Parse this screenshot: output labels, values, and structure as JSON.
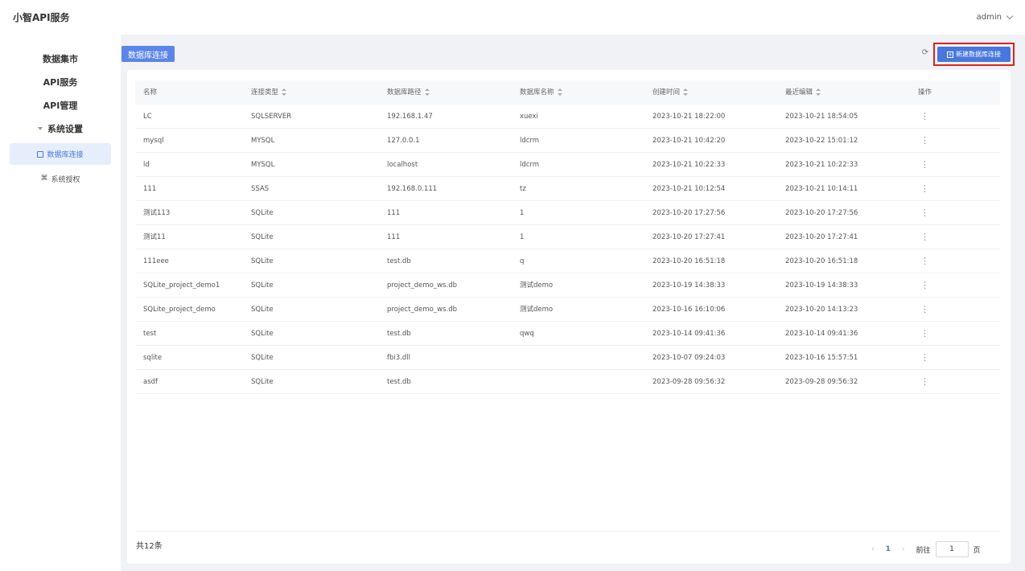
{
  "header": {
    "title": "小智API服务",
    "user": "admin"
  },
  "sidebar": {
    "items": [
      {
        "label": "数据集市"
      },
      {
        "label": "API服务"
      },
      {
        "label": "API管理"
      }
    ],
    "group": {
      "label": "系统设置",
      "children": [
        {
          "label": "数据库连接",
          "icon": "database-icon",
          "active": true
        },
        {
          "label": "系统授权",
          "icon": "authorize-icon"
        }
      ]
    }
  },
  "page": {
    "title": "数据库连接",
    "new_button": "新建数据库连接"
  },
  "table": {
    "columns": [
      "名称",
      "连接类型",
      "数据库路径",
      "数据库名称",
      "创建时间",
      "最近编辑",
      "操作"
    ],
    "rows": [
      [
        "LC",
        "SQLSERVER",
        "192.168.1.47",
        "xuexi",
        "2023-10-21 18:22:00",
        "2023-10-21 18:54:05"
      ],
      [
        "mysql",
        "MYSQL",
        "127.0.0.1",
        "ldcrm",
        "2023-10-21 10:42:20",
        "2023-10-22 15:01:12"
      ],
      [
        "ld",
        "MYSQL",
        "localhost",
        "ldcrm",
        "2023-10-21 10:22:33",
        "2023-10-21 10:22:33"
      ],
      [
        "111",
        "SSAS",
        "192.168.0.111",
        "tz",
        "2023-10-21 10:12:54",
        "2023-10-21 10:14:11"
      ],
      [
        "测试113",
        "SQLite",
        "111",
        "1",
        "2023-10-20 17:27:56",
        "2023-10-20 17:27:56"
      ],
      [
        "测试11",
        "SQLite",
        "111",
        "1",
        "2023-10-20 17:27:41",
        "2023-10-20 17:27:41"
      ],
      [
        "111eee",
        "SQLite",
        "test.db",
        "q",
        "2023-10-20 16:51:18",
        "2023-10-20 16:51:18"
      ],
      [
        "SQLite_project_demo1",
        "SQLite",
        "project_demo_ws.db",
        "测试demo",
        "2023-10-19 14:38:33",
        "2023-10-19 14:38:33"
      ],
      [
        "SQLite_project_demo",
        "SQLite",
        "project_demo_ws.db",
        "测试demo",
        "2023-10-16 16:10:06",
        "2023-10-20 14:13:23"
      ],
      [
        "test",
        "SQLite",
        "test.db",
        "qwq",
        "2023-10-14 09:41:36",
        "2023-10-14 09:41:36"
      ],
      [
        "sqlite",
        "SQLite",
        "fbi3.dll",
        "",
        "2023-10-07 09:24:03",
        "2023-10-16 15:57:51"
      ],
      [
        "asdf",
        "SQLite",
        "test.db",
        "",
        "2023-09-28 09:56:32",
        "2023-09-28 09:56:32"
      ]
    ]
  },
  "footer": {
    "total": "共12条",
    "current_page": "1",
    "goto_label": "前往",
    "goto_value": "1",
    "page_suffix": "页"
  },
  "colors": {
    "accent": "#4a77dd",
    "highlight_border": "#e02020",
    "page_bg": "#f0f2f5"
  }
}
